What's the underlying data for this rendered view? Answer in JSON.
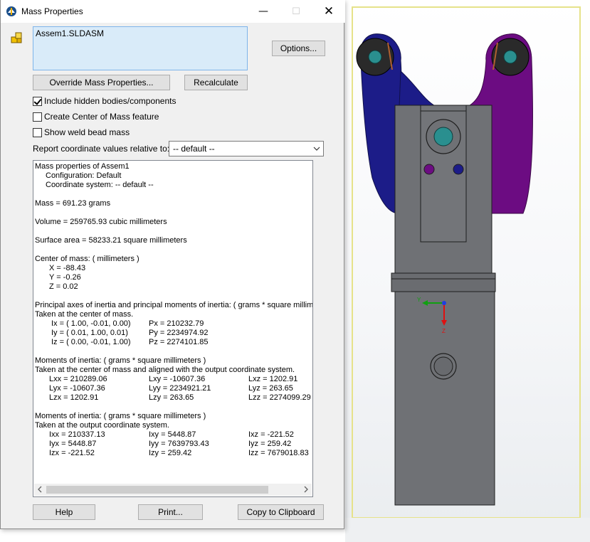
{
  "window": {
    "title": "Mass Properties",
    "controls": {
      "minimize": "—",
      "maximize": "☐",
      "close": "✕"
    }
  },
  "selection": {
    "items": [
      "Assem1.SLDASM"
    ]
  },
  "buttons": {
    "options": "Options...",
    "override": "Override Mass Properties...",
    "recalculate": "Recalculate",
    "help": "Help",
    "print": "Print...",
    "copy": "Copy to Clipboard"
  },
  "checkboxes": [
    {
      "label": "Include hidden bodies/components",
      "checked": true
    },
    {
      "label": "Create Center of Mass feature",
      "checked": false
    },
    {
      "label": "Show weld bead mass",
      "checked": false
    }
  ],
  "coordinate_system": {
    "label": "Report coordinate values relative to:",
    "value": "-- default --"
  },
  "report": {
    "header": "Mass properties of Assem1",
    "configuration": "Configuration: Default",
    "coord_system": "Coordinate system: -- default --",
    "mass": "Mass = 691.23 grams",
    "volume": "Volume = 259765.93 cubic millimeters",
    "surface_area": "Surface area = 58233.21  square millimeters",
    "com_title": "Center of mass: ( millimeters )",
    "com_x": "X = -88.43",
    "com_y": "Y = -0.26",
    "com_z": "Z = 0.02",
    "principal_title": "Principal axes of inertia and principal moments of inertia: ( grams *  square millimeters )",
    "principal_sub": "Taken at the center of mass.",
    "principal_rows": [
      {
        "axis": "Ix = ( 1.00, -0.01,  0.00)",
        "moment": "Px = 210232.79"
      },
      {
        "axis": "Iy = ( 0.01,  1.00,  0.01)",
        "moment": "Py = 2234974.92"
      },
      {
        "axis": "Iz = ( 0.00, -0.01,  1.00)",
        "moment": "Pz = 2274101.85"
      }
    ],
    "moi_com_title": "Moments of inertia: ( grams *  square millimeters )",
    "moi_com_sub": "Taken at the center of mass and aligned with the output coordinate system.",
    "moi_com_rows": [
      [
        "Lxx = 210289.06",
        "Lxy = -10607.36",
        "Lxz = 1202.91"
      ],
      [
        "Lyx = -10607.36",
        "Lyy = 2234921.21",
        "Lyz = 263.65"
      ],
      [
        "Lzx = 1202.91",
        "Lzy = 263.65",
        "Lzz = 2274099.29"
      ]
    ],
    "moi_out_title": "Moments of inertia: ( grams *  square millimeters )",
    "moi_out_sub": "Taken at the output coordinate system.",
    "moi_out_rows": [
      [
        "Ixx = 210337.13",
        "Ixy = 5448.87",
        "Ixz = -221.52"
      ],
      [
        "Iyx = 5448.87",
        "Iyy = 7639793.43",
        "Iyz = 259.42"
      ],
      [
        "Izx = -221.52",
        "Izy = 259.42",
        "Izz = 7679018.83"
      ]
    ]
  },
  "viewport": {
    "triad_labels": {
      "y": "Y",
      "z": "Z"
    },
    "colors": {
      "body_gray": "#6f7175",
      "left_arm": "#1c1c88",
      "right_arm": "#6c0c82",
      "teal": "#2a8f8f",
      "frame_yellow": "#e6e28a"
    }
  }
}
